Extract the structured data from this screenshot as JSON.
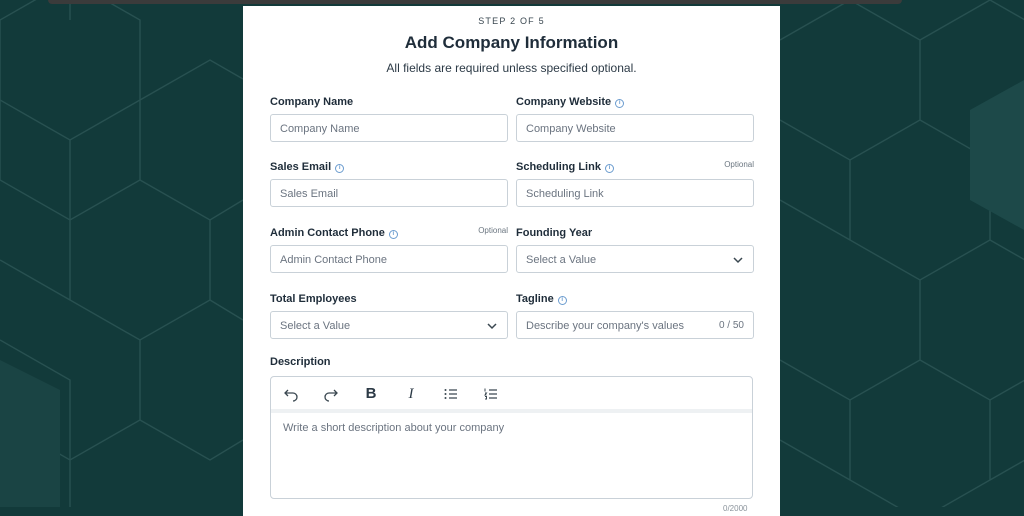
{
  "header": {
    "step": "STEP 2 OF 5",
    "title": "Add Company Information",
    "subtitle": "All fields are required unless specified optional."
  },
  "fields": {
    "company_name": {
      "label": "Company Name",
      "placeholder": "Company Name"
    },
    "company_website": {
      "label": "Company Website",
      "placeholder": "Company Website",
      "has_info": true
    },
    "sales_email": {
      "label": "Sales Email",
      "placeholder": "Sales Email",
      "has_info": true
    },
    "scheduling_link": {
      "label": "Scheduling Link",
      "placeholder": "Scheduling Link",
      "has_info": true,
      "optional": "Optional"
    },
    "admin_phone": {
      "label": "Admin Contact Phone",
      "placeholder": "Admin Contact Phone",
      "has_info": true,
      "optional": "Optional"
    },
    "founding_year": {
      "label": "Founding Year",
      "value": "Select a Value"
    },
    "total_employees": {
      "label": "Total Employees",
      "value": "Select a Value"
    },
    "tagline": {
      "label": "Tagline",
      "placeholder": "Describe your company's values",
      "counter": "0 / 50",
      "has_info": true
    }
  },
  "description": {
    "label": "Description",
    "placeholder": "Write a short description about your company",
    "toolbar": [
      "undo-icon",
      "redo-icon",
      "bold-icon",
      "italic-icon",
      "bullet-list-icon",
      "numbered-list-icon"
    ],
    "counter": "0/2000"
  },
  "colors": {
    "background": "#123a3a",
    "card": "#ffffff",
    "text": "#1f2d3a",
    "info_icon": "#6b9ccf",
    "border": "#c9d1d8"
  }
}
